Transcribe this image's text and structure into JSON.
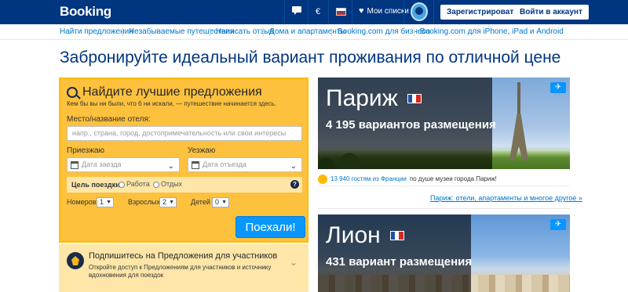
{
  "header": {
    "logo": "Booking",
    "currency": "€",
    "lang_icon": "flag-ru",
    "my_lists": "Мои списки",
    "register": "Зарегистрироваться",
    "login": "Войти в аккаунт"
  },
  "subnav": {
    "items": [
      "Найти предложения",
      "Незабываемые путешествия",
      "Написать отзыв",
      "Дома и апартаменты",
      "Booking.com для бизнеса",
      "Booking.com для iPhone, iPad и Android"
    ]
  },
  "headline": "Забронируйте идеальный вариант проживания по отличной цене",
  "search": {
    "title": "Найдите лучшие предложения",
    "subtitle": "Кем бы вы ни были, что б ни искали, — путешествие начинается здесь.",
    "destination_label": "Место/название отеля:",
    "destination_placeholder": "напр., страна, город, достопримечательность или свои интересы",
    "checkin_label": "Приезжаю",
    "checkin_placeholder": "Дата заезда",
    "checkout_label": "Уезжаю",
    "checkout_placeholder": "Дата отъезда",
    "purpose_label": "Цель поездки:",
    "purpose_work": "Работа",
    "purpose_leisure": "Отдых",
    "help": "?",
    "rooms_label": "Номеров",
    "rooms_value": "1",
    "adults_label": "Взрослых",
    "adults_value": "2",
    "children_label": "Детей",
    "children_value": "0",
    "submit": "Поехали!"
  },
  "promo": {
    "title": "Подпишитесь на Предложения для участников",
    "subtitle": "Откройте доступ к Предложениям для участников и источнику вдохновения для поездок"
  },
  "cards": [
    {
      "city": "Париж",
      "count": "4 195 вариантов размещения",
      "caption_count": "13 940 гостям из Франции",
      "caption_rest": "по душе музеи города Париж!",
      "link": "Париж: отели, апартаменты и многое другое »"
    },
    {
      "city": "Лион",
      "count": "431 вариант размещения"
    }
  ],
  "colors": {
    "brand": "#003580",
    "accent": "#0896ff",
    "search_bg": "#fdc13e",
    "link": "#0077cc"
  }
}
